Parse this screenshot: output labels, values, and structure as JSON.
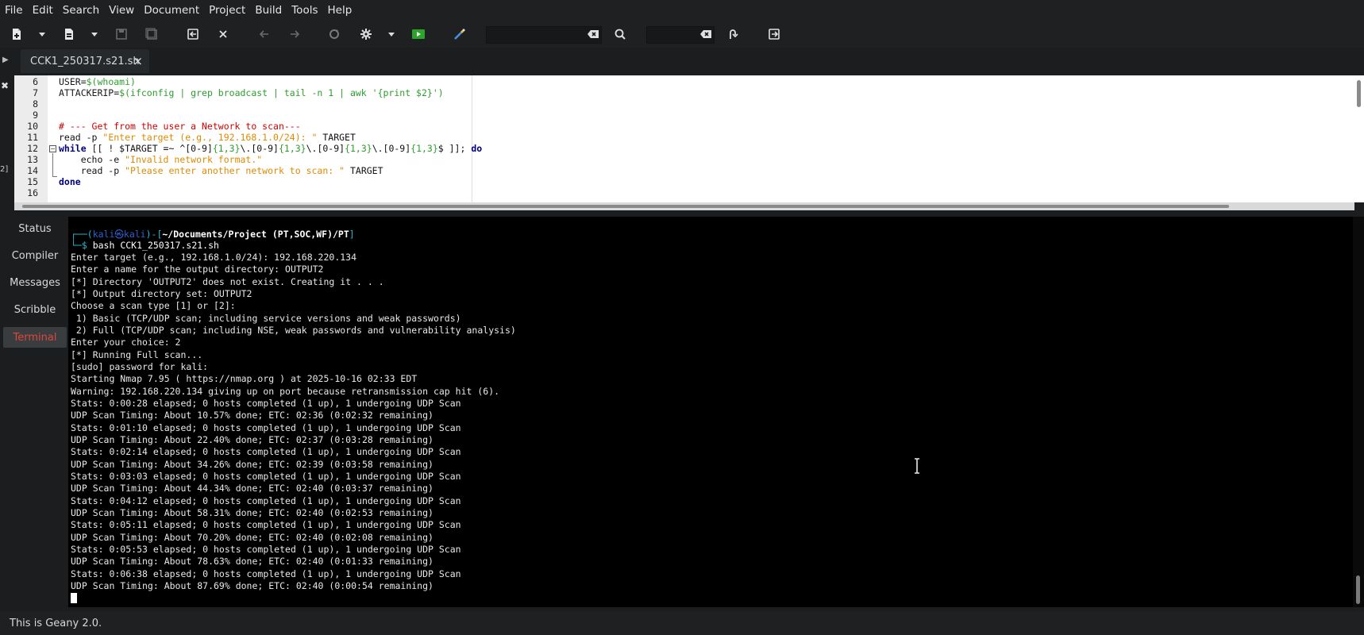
{
  "menu": [
    "File",
    "Edit",
    "Search",
    "View",
    "Document",
    "Project",
    "Build",
    "Tools",
    "Help"
  ],
  "toolbar": {
    "icons": [
      "new-file-icon",
      "new-dropdown-icon",
      "open-file-icon",
      "open-dropdown-icon",
      "save-icon",
      "save-all-icon",
      "revert-icon",
      "close-icon",
      "back-icon",
      "forward-icon",
      "compile-icon",
      "build-icon",
      "build-dropdown-icon",
      "run-icon",
      "color-chooser-icon",
      "clear-search-icon",
      "find-icon",
      "clear-goto-icon",
      "goto-line-icon",
      "quit-icon"
    ],
    "search_value": "",
    "goto_value": ""
  },
  "tab": {
    "filename": "CCK1_250317.s21.sh"
  },
  "editor": {
    "line_numbers": [
      "6",
      "7",
      "8",
      "9",
      "10",
      "11",
      "12",
      "13",
      "14",
      "15",
      "16"
    ],
    "lines": {
      "l6a": "USER=",
      "l6b": "$(whoami)",
      "l7a": "ATTACKERIP=",
      "l7b": "$(ifconfig | grep broadcast | tail -n 1 | awk '{print $2}')",
      "l10": "# --- Get from the user a Network to scan---",
      "l11a": "read -p ",
      "l11b": "\"Enter target (e.g., 192.168.1.0/24): \"",
      "l11c": " TARGET",
      "l12a": "while",
      "l12b": " [[ ! $TARGET =~ ^[0-9]",
      "l12c": "{1,3}",
      "l12d": "\\.[0-9]",
      "l12e": "{1,3}",
      "l12f": "\\.[0-9]",
      "l12g": "{1,3}",
      "l12h": "\\.[0-9]",
      "l12i": "{1,3}",
      "l12j": "$ ]]; ",
      "l12k": "do",
      "l13a": "    echo -e ",
      "l13b": "\"Invalid network format.\"",
      "l14a": "    read -p ",
      "l14b": "\"Please enter another network to scan: \"",
      "l14c": " TARGET",
      "l15": "done"
    }
  },
  "sidebar_tabs": [
    "Status",
    "Compiler",
    "Messages",
    "Scribble",
    "Terminal"
  ],
  "terminal": {
    "prompt": {
      "corner": "┌──(",
      "user": "kali㉿kali",
      "mid": ")-[",
      "dir": "~/Documents/Project (PT,SOC,WF)/PT",
      "end": "]",
      "arrow": "└─$ ",
      "cmd": "bash CCK1_250317.s21.sh"
    },
    "output": [
      "Enter target (e.g., 192.168.1.0/24): 192.168.220.134",
      "Enter a name for the output directory: OUTPUT2",
      "[*] Directory 'OUTPUT2' does not exist. Creating it . . .",
      "[*] Output directory set: OUTPUT2",
      "Choose a scan type [1] or [2]:",
      " 1) Basic (TCP/UDP scan; including service versions and weak passwords)",
      " 2) Full (TCP/UDP scan; including NSE, weak passwords and vulnerability analysis)",
      "Enter your choice: 2",
      "[*] Running Full scan...",
      "[sudo] password for kali:",
      "Starting Nmap 7.95 ( https://nmap.org ) at 2025-10-16 02:33 EDT",
      "Warning: 192.168.220.134 giving up on port because retransmission cap hit (6).",
      "Stats: 0:00:28 elapsed; 0 hosts completed (1 up), 1 undergoing UDP Scan",
      "UDP Scan Timing: About 10.57% done; ETC: 02:36 (0:02:32 remaining)",
      "Stats: 0:01:10 elapsed; 0 hosts completed (1 up), 1 undergoing UDP Scan",
      "UDP Scan Timing: About 22.40% done; ETC: 02:37 (0:03:28 remaining)",
      "Stats: 0:02:14 elapsed; 0 hosts completed (1 up), 1 undergoing UDP Scan",
      "UDP Scan Timing: About 34.26% done; ETC: 02:39 (0:03:58 remaining)",
      "Stats: 0:03:03 elapsed; 0 hosts completed (1 up), 1 undergoing UDP Scan",
      "UDP Scan Timing: About 44.34% done; ETC: 02:40 (0:03:37 remaining)",
      "Stats: 0:04:12 elapsed; 0 hosts completed (1 up), 1 undergoing UDP Scan",
      "UDP Scan Timing: About 58.31% done; ETC: 02:40 (0:02:53 remaining)",
      "Stats: 0:05:11 elapsed; 0 hosts completed (1 up), 1 undergoing UDP Scan",
      "UDP Scan Timing: About 70.20% done; ETC: 02:40 (0:02:08 remaining)",
      "Stats: 0:05:53 elapsed; 0 hosts completed (1 up), 1 undergoing UDP Scan",
      "UDP Scan Timing: About 78.63% done; ETC: 02:40 (0:01:33 remaining)",
      "Stats: 0:06:38 elapsed; 0 hosts completed (1 up), 1 undergoing UDP Scan",
      "UDP Scan Timing: About 87.69% done; ETC: 02:40 (0:00:54 remaining)"
    ]
  },
  "statusbar": {
    "text": "This is Geany 2.0."
  },
  "colors": {
    "active_tab": "#e0453d",
    "background": "#1b1d1f",
    "terminal_bg": "#000000"
  }
}
